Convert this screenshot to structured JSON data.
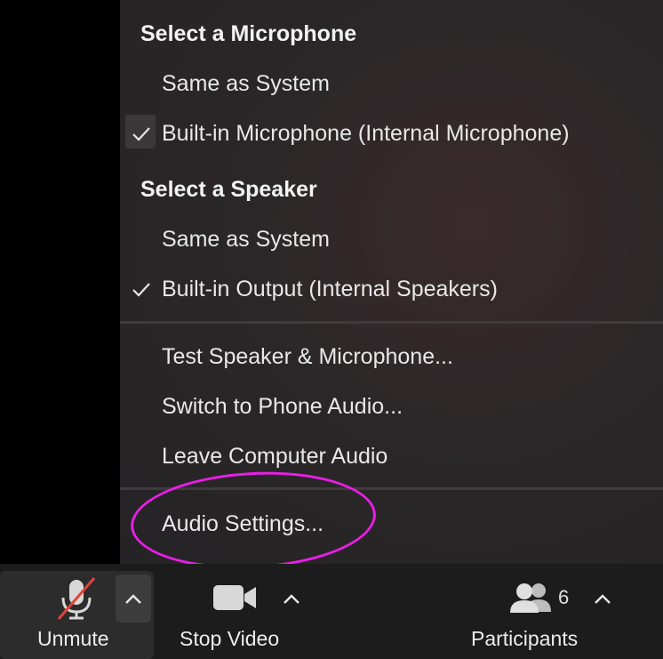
{
  "menu": {
    "microphone_heading": "Select a Microphone",
    "microphone_items": [
      {
        "label": "Same as System",
        "checked": false
      },
      {
        "label": "Built-in Microphone (Internal Microphone)",
        "checked": true
      }
    ],
    "speaker_heading": "Select a Speaker",
    "speaker_items": [
      {
        "label": "Same as System",
        "checked": false
      },
      {
        "label": "Built-in Output (Internal Speakers)",
        "checked": true
      }
    ],
    "actions": [
      {
        "label": "Test Speaker & Microphone..."
      },
      {
        "label": "Switch to Phone Audio..."
      },
      {
        "label": "Leave Computer Audio"
      }
    ],
    "settings": {
      "label": "Audio Settings..."
    }
  },
  "toolbar": {
    "unmute_label": "Unmute",
    "video_label": "Stop Video",
    "participants_label": "Participants",
    "participants_count": "6"
  },
  "colors": {
    "highlight": "#e81ee6",
    "muted_slash": "#e0443a"
  },
  "icons": [
    "checkmark-icon",
    "microphone-muted-icon",
    "video-camera-icon",
    "participants-icon",
    "caret-up-icon"
  ]
}
